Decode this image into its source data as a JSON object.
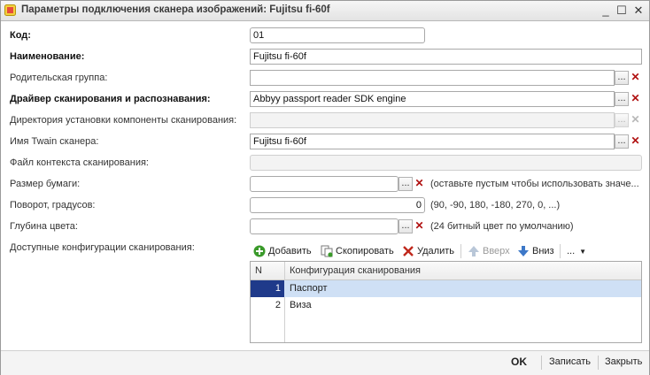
{
  "window": {
    "title": "Параметры подключения сканера изображений: Fujitsu fi-60f",
    "minimize": "_",
    "maximize": "☐",
    "close": "✕"
  },
  "form": {
    "code": {
      "label": "Код:",
      "value": "01"
    },
    "name": {
      "label": "Наименование:",
      "value": "Fujitsu fi-60f"
    },
    "parent_group": {
      "label": "Родительская группа:",
      "value": ""
    },
    "driver": {
      "label": "Драйвер сканирования и распознавания:",
      "value": "Abbyy passport reader SDK engine"
    },
    "install_dir": {
      "label": "Директория установки компоненты сканирования:",
      "value": ""
    },
    "twain_name": {
      "label": "Имя Twain сканера:",
      "value": "Fujitsu fi-60f"
    },
    "context_file": {
      "label": "Файл контекста сканирования:",
      "value": ""
    },
    "paper_size": {
      "label": "Размер бумаги:",
      "value": "",
      "hint": "(оставьте пустым чтобы использовать значе..."
    },
    "rotation": {
      "label": "Поворот, градусов:",
      "value": "0",
      "hint": "(90, -90, 180, -180, 270, 0, ...)"
    },
    "color_depth": {
      "label": "Глубина цвета:",
      "value": "",
      "hint": "(24 битный цвет по умолчанию)"
    },
    "configs_label": "Доступные конфигурации сканирования:"
  },
  "buttons": {
    "select": "...",
    "clear": "✕"
  },
  "toolbar": {
    "add": "Добавить",
    "copy": "Скопировать",
    "delete": "Удалить",
    "up": "Вверх",
    "down": "Вниз",
    "more": "..."
  },
  "table": {
    "columns": [
      "N",
      "Конфигурация сканирования"
    ],
    "rows": [
      {
        "n": "1",
        "name": "Паспорт"
      },
      {
        "n": "2",
        "name": "Виза"
      }
    ]
  },
  "footer": {
    "ok": "OK",
    "save": "Записать",
    "close": "Закрыть"
  },
  "colors": {
    "selection_row": "#cfe0f5",
    "selection_cell": "#1f3a8a",
    "clear_red": "#b01010"
  }
}
